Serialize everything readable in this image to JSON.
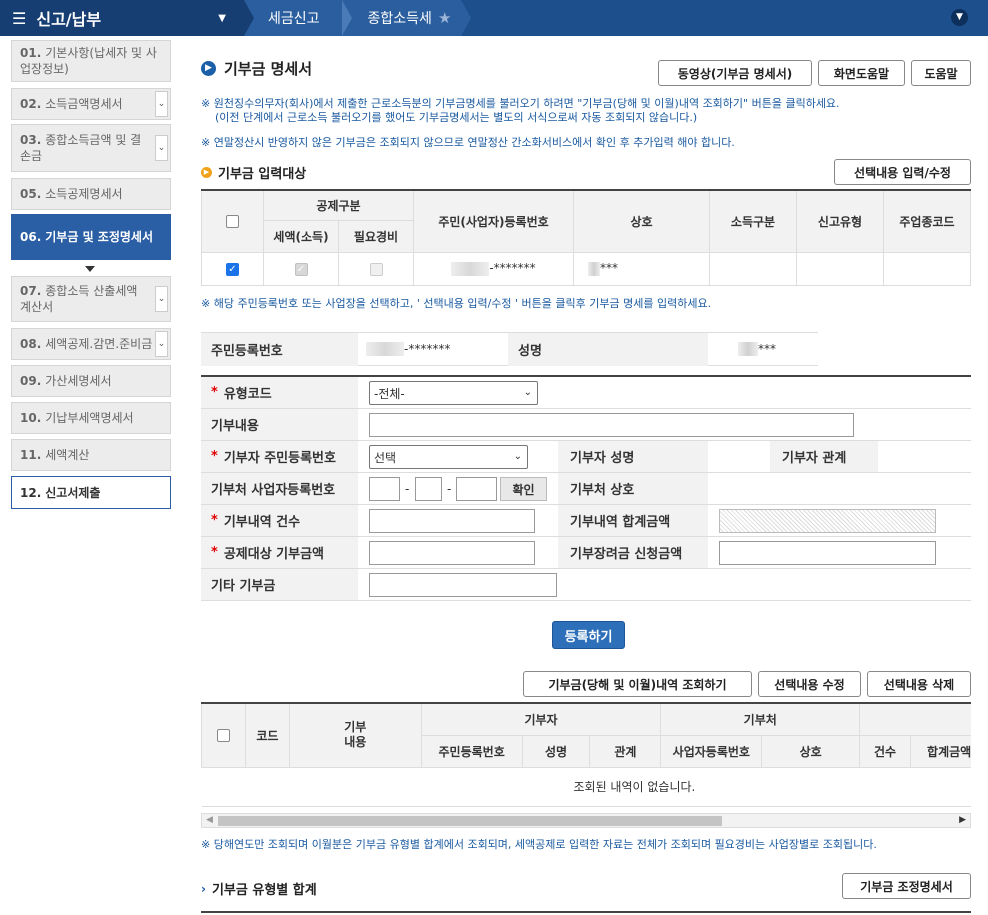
{
  "topbar": {
    "menu_title": "신고/납부",
    "breadcrumb1": "세금신고",
    "breadcrumb2": "종합소득세"
  },
  "sidebar": {
    "items": [
      {
        "num": "01.",
        "label": "기본사항(납세자 및 사업장정보)"
      },
      {
        "num": "02.",
        "label": "소득금액명세서"
      },
      {
        "num": "03.",
        "label": "종합소득금액 및 결손금"
      },
      {
        "num": "05.",
        "label": "소득공제명세서"
      },
      {
        "num": "06.",
        "label": "기부금 및 조정명세서"
      },
      {
        "num": "07.",
        "label": "종합소득 산출세액계산서"
      },
      {
        "num": "08.",
        "label": "세액공제.감면.준비금"
      },
      {
        "num": "09.",
        "label": "가산세명세서"
      },
      {
        "num": "10.",
        "label": "기납부세액명세서"
      },
      {
        "num": "11.",
        "label": "세액계산"
      },
      {
        "num": "12.",
        "label": "신고서제출"
      }
    ]
  },
  "page": {
    "title": "기부금 명세서",
    "video_btn": "동영상(기부금 명세서)",
    "screen_help_btn": "화면도움말",
    "help_btn": "도움말",
    "note1": "※ 원천징수의무자(회사)에서 제출한 근로소득분의 기부금명세를 불러오기 하려면 \"기부금(당해 및 이월)내역 조회하기\" 버튼을 클릭하세요.",
    "note1b": "(이전 단계에서 근로소득 불러오기를 했어도 기부금명세서는 별도의 서식으로써 자동 조회되지 않습니다.)",
    "note2": "※ 연말정산시 반영하지 않은 기부금은 조회되지 않으므로 연말정산 간소화서비스에서 확인 후 추가입력 해야 합니다."
  },
  "target_section": {
    "title": "기부금 입력대상",
    "edit_btn": "선택내용 입력/수정",
    "headers": {
      "deduction": "공제구분",
      "tax": "세액(소득)",
      "expense": "필요경비",
      "regno": "주민(사업자)등록번호",
      "company": "상호",
      "income_type": "소득구분",
      "report_type": "신고유형",
      "industry": "주업종코드"
    },
    "row": {
      "regno_masked": "-*******",
      "company_masked": "***"
    },
    "note": "※ 해당 주민등록번호 또는 사업장을 선택하고, ' 선택내용 입력/수정 ' 버튼을 클릭후 기부금 명세를 입력하세요."
  },
  "info": {
    "regno_label": "주민등록번호",
    "regno_value": "-*******",
    "name_label": "성명",
    "name_value": "***"
  },
  "form": {
    "type_code_label": "유형코드",
    "type_code_value": "-전체-",
    "content_label": "기부내용",
    "donor_regno_label": "기부자 주민등록번호",
    "donor_regno_value": "선택",
    "donor_name_label": "기부자 성명",
    "donor_relation_label": "기부자 관계",
    "recipient_bizno_label": "기부처 사업자등록번호",
    "confirm_btn": "확인",
    "recipient_name_label": "기부처 상호",
    "count_label": "기부내역 건수",
    "total_label": "기부내역 합계금액",
    "deductible_label": "공제대상 기부금액",
    "incentive_label": "기부장려금 신청금액",
    "other_label": "기타 기부금",
    "register_btn": "등록하기"
  },
  "list_section": {
    "query_btn": "기부금(당해 및 이월)내역 조회하기",
    "modify_btn": "선택내용 수정",
    "delete_btn": "선택내용 삭제",
    "headers": {
      "code": "코드",
      "content": "기부\n내용",
      "donor": "기부자",
      "recipient": "기부처",
      "donor_regno": "주민등록번호",
      "donor_name": "성명",
      "donor_relation": "관계",
      "biz_regno": "사업자등록번호",
      "biz_name": "상호",
      "count": "건수",
      "total": "합계금액"
    },
    "empty_message": "조회된 내역이 없습니다.",
    "note": "※ 당해연도만 조회되며 이월분은 기부금 유형별 합계에서 조회되며, 세액공제로 입력한 자료는 전체가 조회되며 필요경비는 사업장별로 조회됩니다."
  },
  "summary_section": {
    "title": "기부금 유형별 합계",
    "adjust_btn": "기부금 조정명세서"
  }
}
